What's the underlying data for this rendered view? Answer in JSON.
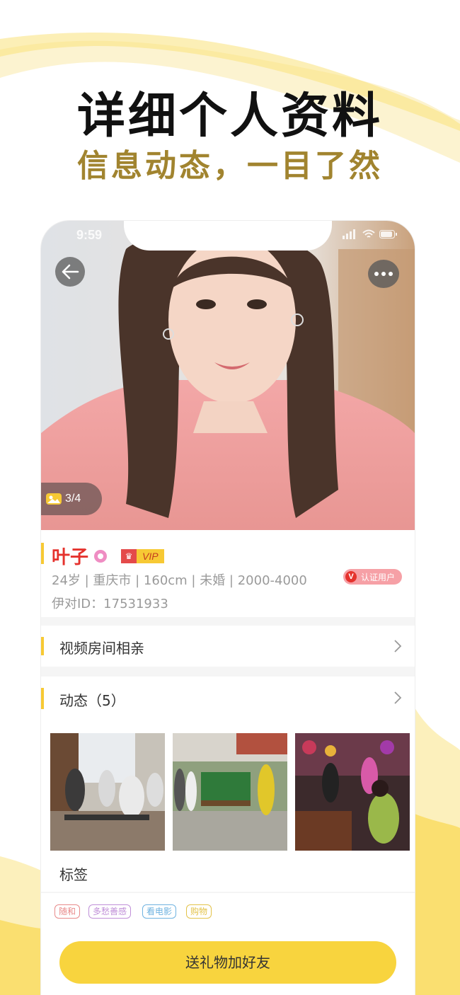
{
  "header": {
    "title": "详细个人资料",
    "subtitle": "信息动态，一目了然"
  },
  "status_bar": {
    "time": "9:59"
  },
  "photo": {
    "counter": "3/4"
  },
  "profile": {
    "name": "叶子",
    "vip_label": "VIP",
    "info": "24岁 | 重庆市 | 160cm | 未婚 | 2000-4000",
    "id_line": "伊对ID：17531933",
    "verified_label": "认证用户",
    "verified_badge": "V"
  },
  "rows": {
    "video_room": "视频房间相亲",
    "moments": "动态（5）",
    "tags_title": "标签"
  },
  "tags": [
    {
      "label": "随和",
      "color": "#e88a8a"
    },
    {
      "label": "多愁善感",
      "color": "#c08fd8"
    },
    {
      "label": "看电影",
      "color": "#6fb3e0"
    },
    {
      "label": "购物",
      "color": "#e3c34a"
    }
  ],
  "cta": {
    "label": "送礼物加好友"
  },
  "colors": {
    "accent": "#f7c934",
    "name": "#e5322d",
    "subtitle": "#a1842f",
    "button": "#f8d43e"
  }
}
